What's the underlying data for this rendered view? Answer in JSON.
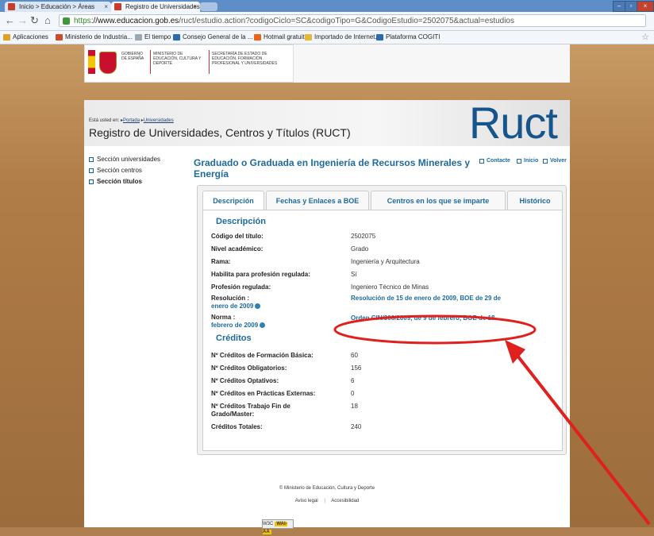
{
  "browser": {
    "tabs": [
      {
        "label": "Inicio > Educación > Áreas"
      },
      {
        "label": "Registro de Universidades, C"
      }
    ],
    "url": {
      "scheme": "https",
      "host": "://www.educacion.gob.es",
      "path": "/ruct/estudio.action?codigoCiclo=SC&codigoTipo=G&CodigoEstudio=2502075&actual=estudios"
    },
    "bookmarks": [
      {
        "label": "Aplicaciones",
        "color": "#e0a020"
      },
      {
        "label": "Ministerio de Industria...",
        "color": "#d04a2a"
      },
      {
        "label": "El tiempo",
        "color": "#9aa7b4"
      },
      {
        "label": "Consejo General de la ...",
        "color": "#2b6cb0"
      },
      {
        "label": "Hotmail gratuito",
        "color": "#e8641b"
      },
      {
        "label": "Importado de Internet...",
        "color": "#e6b838"
      },
      {
        "label": "Plataforma COGITI",
        "color": "#2b6cb0"
      }
    ]
  },
  "gov": {
    "gobierno": "GOBIERNO DE ESPAÑA",
    "ministerio": "MINISTERIO DE EDUCACIÓN, CULTURA Y DEPORTE",
    "secretaria": "SECRETARÍA DE ESTADO DE EDUCACIÓN, FORMACIÓN PROFESIONAL Y UNIVERSIDADES"
  },
  "banner": {
    "logo": "Ruct",
    "breadcrumb_prefix": "Está usted en:",
    "breadcrumb": [
      "Portada",
      "Universidades"
    ],
    "title": "Registro de Universidades, Centros y Títulos (RUCT)"
  },
  "sidebar": [
    "Sección universidades",
    "Sección centros",
    "Sección títulos"
  ],
  "main": {
    "title": "Graduado o Graduada en Ingeniería de Recursos Minerales y Energía",
    "links": [
      "Contacte",
      "Inicio",
      "Volver"
    ],
    "tabs": [
      "Descripción",
      "Fechas y Enlaces a BOE",
      "Centros en los que se imparte",
      "Histórico"
    ]
  },
  "descripcion": {
    "heading": "Descripción",
    "rows": [
      {
        "label": "Código del título:",
        "value": "2502075"
      },
      {
        "label": "Nivel académico:",
        "value": "Grado"
      },
      {
        "label": "Rama:",
        "value": "Ingeniería y Arquitectura"
      },
      {
        "label": "Habilita para profesión regulada:",
        "value": "Sí"
      },
      {
        "label": "Profesión regulada:",
        "value": "Ingeniero Técnico de Minas"
      }
    ],
    "resolucion": {
      "label": "Resolución :",
      "value": "Resolución de 15 de enero de 2009, BOE de 29 de",
      "cont": "enero de 2009"
    },
    "norma": {
      "label": "Norma :",
      "value": "Orden CIN/306/2009, de 9 de febrero, BOE de 18",
      "cont": "febrero de 2009"
    }
  },
  "creditos": {
    "heading": "Créditos",
    "rows": [
      {
        "label": "Nº Créditos de Formación Básica:",
        "value": "60"
      },
      {
        "label": "Nº Créditos Obligatorios:",
        "value": "156"
      },
      {
        "label": "Nº Créditos Optativos:",
        "value": "6"
      },
      {
        "label": "Nº Créditos en Prácticas Externas:",
        "value": "0"
      },
      {
        "label": "Nº Créditos Trabajo Fin de",
        "label2": "Grado/Master:",
        "value": "18"
      },
      {
        "label": "Créditos Totales:",
        "value": "240"
      }
    ]
  },
  "footer": {
    "copyright": "© Ministerio de Educación, Cultura y Deporte",
    "aviso": "Aviso legal",
    "accesibilidad": "Accesibilidad",
    "wai": "WAI-AA"
  },
  "annotation_color": "#e0201c"
}
